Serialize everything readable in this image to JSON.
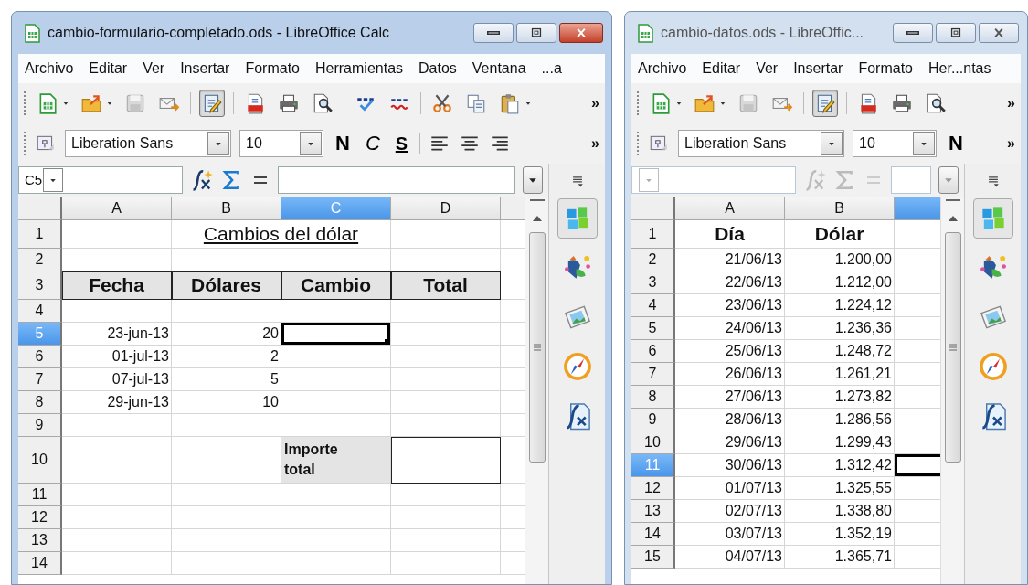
{
  "windows": [
    {
      "title": "cambio-formulario-completado.ods - LibreOffice Calc",
      "active": true,
      "menu": [
        "Archivo",
        "Editar",
        "Ver",
        "Insertar",
        "Formato",
        "Herramientas",
        "Datos",
        "Ventana",
        "...a"
      ],
      "standard_toolbar": {
        "icons": [
          {
            "kind": "new"
          },
          {
            "kind": "caret"
          },
          {
            "kind": "open"
          },
          {
            "kind": "caret"
          },
          {
            "kind": "save"
          },
          {
            "kind": "mail"
          },
          {
            "kind": "sep"
          },
          {
            "kind": "edit"
          },
          {
            "kind": "sep"
          },
          {
            "kind": "pdf"
          },
          {
            "kind": "print"
          },
          {
            "kind": "preview"
          },
          {
            "kind": "sep"
          },
          {
            "kind": "spell"
          },
          {
            "kind": "autospell"
          },
          {
            "kind": "sep"
          },
          {
            "kind": "cut"
          },
          {
            "kind": "copy"
          },
          {
            "kind": "paste"
          },
          {
            "kind": "caret"
          }
        ],
        "edit_pressed": true,
        "more": "»"
      },
      "formatting_toolbar": {
        "font": "Liberation Sans",
        "size": "10",
        "buttons": [
          {
            "kind": "bold",
            "text": "N"
          },
          {
            "kind": "italic",
            "text": "C"
          },
          {
            "kind": "underline",
            "text": "S"
          }
        ],
        "align": [
          {
            "kind": "left"
          },
          {
            "kind": "center"
          },
          {
            "kind": "right"
          }
        ],
        "more": "»"
      },
      "name_box": "C5",
      "sidebar": [
        {
          "kind": "properties",
          "selected": true
        },
        {
          "kind": "styles",
          "selected": false
        },
        {
          "kind": "gallery",
          "selected": false
        },
        {
          "kind": "navigator",
          "selected": false
        },
        {
          "kind": "functions",
          "selected": false
        }
      ],
      "columns": [
        {
          "label": "A",
          "selected": false
        },
        {
          "label": "B",
          "selected": false
        },
        {
          "label": "C",
          "selected": true
        },
        {
          "label": "D",
          "selected": false
        }
      ],
      "rows": [
        {
          "number": "1",
          "selected": false,
          "cells": [
            {
              "kind": "blank"
            },
            {
              "kind": "title",
              "text": "Cambios del dólar"
            },
            {
              "kind": "blank"
            }
          ]
        },
        {
          "number": "2",
          "selected": false,
          "cells": [
            {
              "kind": "blank"
            },
            {
              "kind": "blank"
            },
            {
              "kind": "blank"
            },
            {
              "kind": "blank"
            }
          ]
        },
        {
          "number": "3",
          "selected": false,
          "cells": [
            {
              "kind": "header",
              "text": "Fecha"
            },
            {
              "kind": "header",
              "text": "Dólares"
            },
            {
              "kind": "header",
              "text": "Cambio"
            },
            {
              "kind": "header",
              "text": "Total"
            }
          ]
        },
        {
          "number": "4",
          "selected": false,
          "cells": [
            {
              "kind": "blank"
            },
            {
              "kind": "blank"
            },
            {
              "kind": "blank"
            },
            {
              "kind": "blank"
            }
          ]
        },
        {
          "number": "5",
          "selected": true,
          "cells": [
            {
              "kind": "date",
              "text": "23-jun-13"
            },
            {
              "kind": "number",
              "text": "20"
            },
            {
              "kind": "blank"
            },
            {
              "kind": "blank"
            }
          ]
        },
        {
          "number": "6",
          "selected": false,
          "cells": [
            {
              "kind": "date",
              "text": "01-jul-13"
            },
            {
              "kind": "number",
              "text": "2"
            },
            {
              "kind": "blank"
            },
            {
              "kind": "blank"
            }
          ]
        },
        {
          "number": "7",
          "selected": false,
          "cells": [
            {
              "kind": "date",
              "text": "07-jul-13"
            },
            {
              "kind": "number",
              "text": "5"
            },
            {
              "kind": "blank"
            },
            {
              "kind": "blank"
            }
          ]
        },
        {
          "number": "8",
          "selected": false,
          "cells": [
            {
              "kind": "date",
              "text": "29-jun-13"
            },
            {
              "kind": "number",
              "text": "10"
            },
            {
              "kind": "blank"
            },
            {
              "kind": "blank"
            }
          ]
        },
        {
          "number": "9",
          "selected": false,
          "cells": [
            {
              "kind": "blank"
            },
            {
              "kind": "blank"
            },
            {
              "kind": "blank"
            },
            {
              "kind": "blank"
            }
          ]
        },
        {
          "number": "10",
          "selected": false,
          "cells": [
            {
              "kind": "blank"
            },
            {
              "kind": "blank"
            },
            {
              "kind": "label",
              "text": "Importe total"
            },
            {
              "kind": "box"
            }
          ]
        },
        {
          "number": "11",
          "selected": false,
          "cells": [
            {
              "kind": "blank"
            },
            {
              "kind": "blank"
            },
            {
              "kind": "blank"
            },
            {
              "kind": "blank"
            }
          ]
        },
        {
          "number": "12",
          "selected": false,
          "cells": [
            {
              "kind": "blank"
            },
            {
              "kind": "blank"
            },
            {
              "kind": "blank"
            },
            {
              "kind": "blank"
            }
          ]
        },
        {
          "number": "13",
          "selected": false,
          "cells": [
            {
              "kind": "blank"
            },
            {
              "kind": "blank"
            },
            {
              "kind": "blank"
            },
            {
              "kind": "blank"
            }
          ]
        },
        {
          "number": "14",
          "selected": false,
          "cells": [
            {
              "kind": "blank"
            },
            {
              "kind": "blank"
            },
            {
              "kind": "blank"
            },
            {
              "kind": "blank"
            }
          ]
        }
      ]
    },
    {
      "title": "cambio-datos.ods - LibreOffic...",
      "active": false,
      "menu": [
        "Archivo",
        "Editar",
        "Ver",
        "Insertar",
        "Formato",
        "Her...ntas"
      ],
      "standard_toolbar": {
        "icons": [
          {
            "kind": "new"
          },
          {
            "kind": "caret"
          },
          {
            "kind": "open"
          },
          {
            "kind": "caret"
          },
          {
            "kind": "save"
          },
          {
            "kind": "mail"
          },
          {
            "kind": "sep"
          },
          {
            "kind": "edit"
          },
          {
            "kind": "sep"
          },
          {
            "kind": "pdf"
          },
          {
            "kind": "print"
          },
          {
            "kind": "preview"
          }
        ],
        "edit_pressed": true,
        "more": "»"
      },
      "formatting_toolbar": {
        "font": "Liberation Sans",
        "size": "10",
        "buttons": [
          {
            "kind": "bold",
            "text": "N"
          }
        ],
        "more": "»"
      },
      "sidebar": [
        {
          "kind": "properties",
          "selected": true
        },
        {
          "kind": "styles",
          "selected": false
        },
        {
          "kind": "gallery",
          "selected": false
        },
        {
          "kind": "navigator",
          "selected": false
        },
        {
          "kind": "functions",
          "selected": false
        }
      ],
      "columns": [
        {
          "label": "A",
          "selected": false
        },
        {
          "label": "B",
          "selected": false
        },
        {
          "selected": true
        }
      ],
      "rows": [
        {
          "number": "1",
          "selected": false,
          "cells": [
            {
              "kind": "heading",
              "text": "Día"
            },
            {
              "kind": "heading",
              "text": "Dólar"
            },
            {
              "kind": "blank"
            }
          ]
        },
        {
          "number": "2",
          "selected": false,
          "cells": [
            {
              "kind": "date",
              "text": "21/06/13"
            },
            {
              "kind": "number",
              "text": "1.200,00"
            },
            {
              "kind": "blank"
            }
          ]
        },
        {
          "number": "3",
          "selected": false,
          "cells": [
            {
              "kind": "date",
              "text": "22/06/13"
            },
            {
              "kind": "number",
              "text": "1.212,00"
            },
            {
              "kind": "blank"
            }
          ]
        },
        {
          "number": "4",
          "selected": false,
          "cells": [
            {
              "kind": "date",
              "text": "23/06/13"
            },
            {
              "kind": "number",
              "text": "1.224,12"
            },
            {
              "kind": "blank"
            }
          ]
        },
        {
          "number": "5",
          "selected": false,
          "cells": [
            {
              "kind": "date",
              "text": "24/06/13"
            },
            {
              "kind": "number",
              "text": "1.236,36"
            },
            {
              "kind": "blank"
            }
          ]
        },
        {
          "number": "6",
          "selected": false,
          "cells": [
            {
              "kind": "date",
              "text": "25/06/13"
            },
            {
              "kind": "number",
              "text": "1.248,72"
            },
            {
              "kind": "blank"
            }
          ]
        },
        {
          "number": "7",
          "selected": false,
          "cells": [
            {
              "kind": "date",
              "text": "26/06/13"
            },
            {
              "kind": "number",
              "text": "1.261,21"
            },
            {
              "kind": "blank"
            }
          ]
        },
        {
          "number": "8",
          "selected": false,
          "cells": [
            {
              "kind": "date",
              "text": "27/06/13"
            },
            {
              "kind": "number",
              "text": "1.273,82"
            },
            {
              "kind": "blank"
            }
          ]
        },
        {
          "number": "9",
          "selected": false,
          "cells": [
            {
              "kind": "date",
              "text": "28/06/13"
            },
            {
              "kind": "number",
              "text": "1.286,56"
            },
            {
              "kind": "blank"
            }
          ]
        },
        {
          "number": "10",
          "selected": false,
          "cells": [
            {
              "kind": "date",
              "text": "29/06/13"
            },
            {
              "kind": "number",
              "text": "1.299,43"
            },
            {
              "kind": "blank"
            }
          ]
        },
        {
          "number": "11",
          "selected": true,
          "cells": [
            {
              "kind": "date",
              "text": "30/06/13"
            },
            {
              "kind": "number",
              "text": "1.312,42"
            },
            {
              "kind": "blank"
            }
          ]
        },
        {
          "number": "12",
          "selected": false,
          "cells": [
            {
              "kind": "date",
              "text": "01/07/13"
            },
            {
              "kind": "number",
              "text": "1.325,55"
            },
            {
              "kind": "blank"
            }
          ]
        },
        {
          "number": "13",
          "selected": false,
          "cells": [
            {
              "kind": "date",
              "text": "02/07/13"
            },
            {
              "kind": "number",
              "text": "1.338,80"
            },
            {
              "kind": "blank"
            }
          ]
        },
        {
          "number": "14",
          "selected": false,
          "cells": [
            {
              "kind": "date",
              "text": "03/07/13"
            },
            {
              "kind": "number",
              "text": "1.352,19"
            },
            {
              "kind": "blank"
            }
          ]
        },
        {
          "number": "15",
          "selected": false,
          "cells": [
            {
              "kind": "date",
              "text": "04/07/13"
            },
            {
              "kind": "number",
              "text": "1.365,71"
            },
            {
              "kind": "blank"
            }
          ]
        }
      ]
    }
  ]
}
